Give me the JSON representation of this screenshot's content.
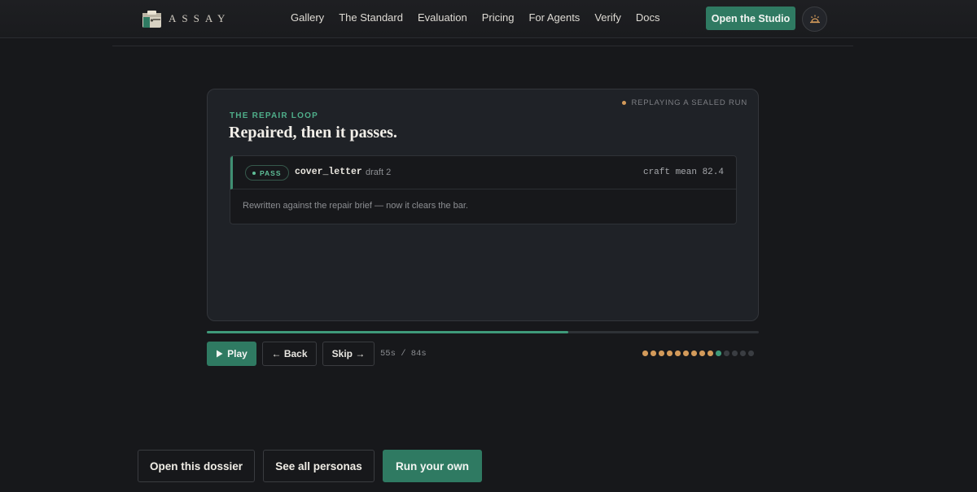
{
  "brand": {
    "name": "ASSAY"
  },
  "nav": {
    "items": [
      "Gallery",
      "The Standard",
      "Evaluation",
      "Pricing",
      "For Agents",
      "Verify",
      "Docs"
    ],
    "studio_label": "Open the Studio",
    "theme_icon": "sun-icon"
  },
  "card": {
    "status": "REPLAYING A SEALED RUN",
    "eyebrow": "THE REPAIR LOOP",
    "title": "Repaired, then it passes.",
    "result": {
      "badge": "PASS",
      "file": "cover_letter",
      "draft": "draft 2",
      "score": "craft mean 82.4",
      "body": "Rewritten against the repair brief — now it clears the bar."
    }
  },
  "player": {
    "progress": 0.655,
    "play_label": "Play",
    "back_label": "← Back",
    "skip_label": "Skip →",
    "time": "55s / 84s",
    "steps_total": 14,
    "steps_done": 9,
    "current_step": 10
  },
  "colors": {
    "accent": "#2f7a62",
    "pass": "#5fbf98",
    "step_done": "#d39a5a",
    "step_current": "#3f9a7a",
    "step_pending": "#3a3d42"
  },
  "actions": {
    "dossier_label": "Open this dossier",
    "personas_label": "See all personas",
    "run_label": "Run your own"
  }
}
